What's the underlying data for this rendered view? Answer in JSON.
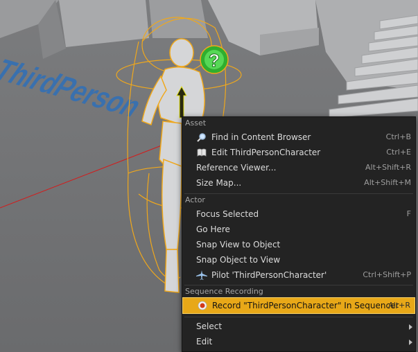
{
  "viewport": {
    "floor_text": "ThirdPerson",
    "help_icon_glyph": "?"
  },
  "context_menu": {
    "sections": {
      "asset": "Asset",
      "actor": "Actor",
      "sequence_recording": "Sequence Recording"
    },
    "items": {
      "find_in_content_browser": {
        "label": "Find in Content Browser",
        "shortcut": "Ctrl+B",
        "icon": "magnifier-icon"
      },
      "edit": {
        "label": "Edit ThirdPersonCharacter",
        "shortcut": "Ctrl+E",
        "icon": "book-icon"
      },
      "reference_viewer": {
        "label": "Reference Viewer...",
        "shortcut": "Alt+Shift+R"
      },
      "size_map": {
        "label": "Size Map...",
        "shortcut": "Alt+Shift+M"
      },
      "focus_selected": {
        "label": "Focus Selected",
        "shortcut": "F"
      },
      "go_here": {
        "label": "Go Here"
      },
      "snap_view_to_object": {
        "label": "Snap View to Object"
      },
      "snap_object_to_view": {
        "label": "Snap Object to View"
      },
      "pilot": {
        "label": "Pilot 'ThirdPersonCharacter'",
        "shortcut": "Ctrl+Shift+P",
        "icon": "airplane-icon"
      },
      "record": {
        "label": "Record \"ThirdPersonCharacter\" In Sequencer",
        "shortcut": "Alt+R",
        "icon": "record-icon"
      },
      "select": {
        "label": "Select"
      },
      "edit_submenu": {
        "label": "Edit"
      }
    }
  },
  "colors": {
    "highlight": "#e8a818",
    "selection_outline": "#f0a81c",
    "menu_bg": "#232323"
  }
}
